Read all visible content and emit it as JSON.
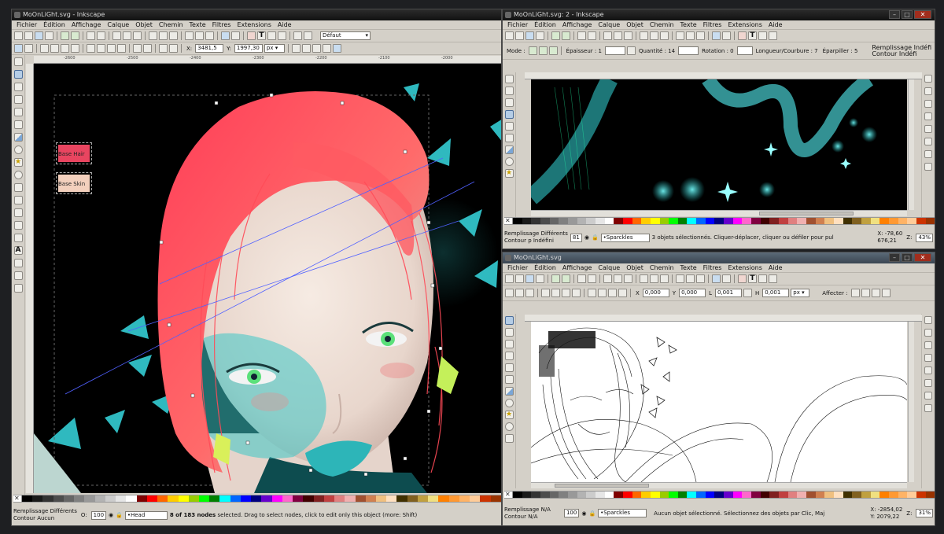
{
  "windows": {
    "main": {
      "title": "MoOnLiGht.svg - Inkscape",
      "menu": [
        "Fichier",
        "Édition",
        "Affichage",
        "Calque",
        "Objet",
        "Chemin",
        "Texte",
        "Filtres",
        "Extensions",
        "Aide"
      ],
      "style_select": "Défaut",
      "coords": {
        "x_label": "X:",
        "x_value": "3481,5",
        "y_label": "Y:",
        "y_value": "1997,30",
        "unit": "px"
      },
      "swatches": [
        {
          "label": "Base Hair",
          "color": "#e94560"
        },
        {
          "label": "Base Skin",
          "color": "#f3d0bd"
        }
      ],
      "status": {
        "fill_label": "Remplissage",
        "stroke_label": "Contour",
        "fill_value": "Différents",
        "stroke_value": "Aucun",
        "opacity_value": "100",
        "layer": "•Head",
        "message_count": "8 of 183 nodes",
        "message": " selected. Drag to select nodes, click to edit only this object (more: Shift)"
      }
    },
    "spray": {
      "title": "MoOnLiGht.svg: 2 - Inkscape",
      "menu": [
        "Fichier",
        "Édition",
        "Affichage",
        "Calque",
        "Objet",
        "Chemin",
        "Texte",
        "Filtres",
        "Extensions",
        "Aide"
      ],
      "controls": {
        "mode_label": "Mode :",
        "width_label": "Épaisseur : 1",
        "quantity_label": "Quantité : 14",
        "rotation_label": "Rotation : 0",
        "length_label": "Longueur/Courbure : 7",
        "scatter_label": "Éparpiller : 5",
        "fill_label": "Remplissage",
        "fill_value": "Indéfi",
        "stroke_label": "Contour",
        "stroke_value": "Indéfi"
      },
      "status": {
        "fill_label": "Remplissage",
        "stroke_label": "Contour",
        "fill_value": "Différents",
        "stroke_value": "p Indéfini",
        "opacity_value": "81",
        "layer": "•Sparckles",
        "message": "3 objets sélectionnés. Cliquer-déplacer, cliquer ou défiler pour pul",
        "cursor_x": "X: -78,60",
        "cursor_y": "676,21",
        "zoom_label": "Z:",
        "zoom": "43%"
      }
    },
    "outline": {
      "title": "MoOnLiGht.svg",
      "menu": [
        "Fichier",
        "Édition",
        "Affichage",
        "Calque",
        "Objet",
        "Chemin",
        "Texte",
        "Filtres",
        "Extensions",
        "Aide"
      ],
      "fields": [
        "0,000",
        "0,000",
        "0,001",
        "0,001"
      ],
      "unit": "px",
      "affect_label": "Affecter :",
      "status": {
        "fill_label": "Remplissage",
        "stroke_label": "Contour",
        "fill_value": "N/A",
        "stroke_value": "N/A",
        "opacity_value": "100",
        "layer": "•Sparckles",
        "message": "Aucun objet sélectionné.  Sélectionnez des objets par Clic, Maj",
        "cursor_x": "X: -2854,02",
        "cursor_y": "Y: 2079,22",
        "zoom_label": "Z:",
        "zoom": "31%"
      }
    }
  },
  "palette_colors": [
    "#000000",
    "#1a1a1a",
    "#333333",
    "#4d4d4d",
    "#666666",
    "#808080",
    "#999999",
    "#b3b3b3",
    "#cccccc",
    "#e6e6e6",
    "#ffffff",
    "#800000",
    "#ff0000",
    "#ff6600",
    "#ffcc00",
    "#ffff00",
    "#99cc00",
    "#00ff00",
    "#008000",
    "#00ffff",
    "#0066ff",
    "#0000ff",
    "#000080",
    "#6600cc",
    "#ff00ff",
    "#ff66cc",
    "#800040",
    "#400000",
    "#802020",
    "#c04040",
    "#e08080",
    "#f0b0b0",
    "#a05030",
    "#d08050",
    "#f0c080",
    "#ffe0c0",
    "#403000",
    "#806020",
    "#c0a040",
    "#f0e080",
    "#ff8000",
    "#ff9933",
    "#ffb366",
    "#ffcc99",
    "#cc3300",
    "#993300"
  ],
  "accents": {
    "hair": "#ff4d5a",
    "teal": "#2ec4c4",
    "skin": "#f1ddd2",
    "node": "#ffffff",
    "selection": "#4040ff"
  },
  "icons": [
    "new-icon",
    "open-icon",
    "save-icon",
    "print-icon",
    "import-icon",
    "export-icon",
    "undo-icon",
    "redo-icon",
    "copy-icon",
    "cut-icon",
    "paste-icon",
    "zoom-icon",
    "select-tool-icon",
    "node-tool-icon",
    "tweak-tool-icon",
    "spray-tool-icon",
    "rect-tool-icon",
    "ellipse-tool-icon",
    "star-tool-icon",
    "spiral-tool-icon",
    "pencil-tool-icon",
    "pen-tool-icon",
    "calligraphy-tool-icon",
    "text-tool-icon",
    "gradient-tool-icon",
    "dropper-tool-icon"
  ]
}
